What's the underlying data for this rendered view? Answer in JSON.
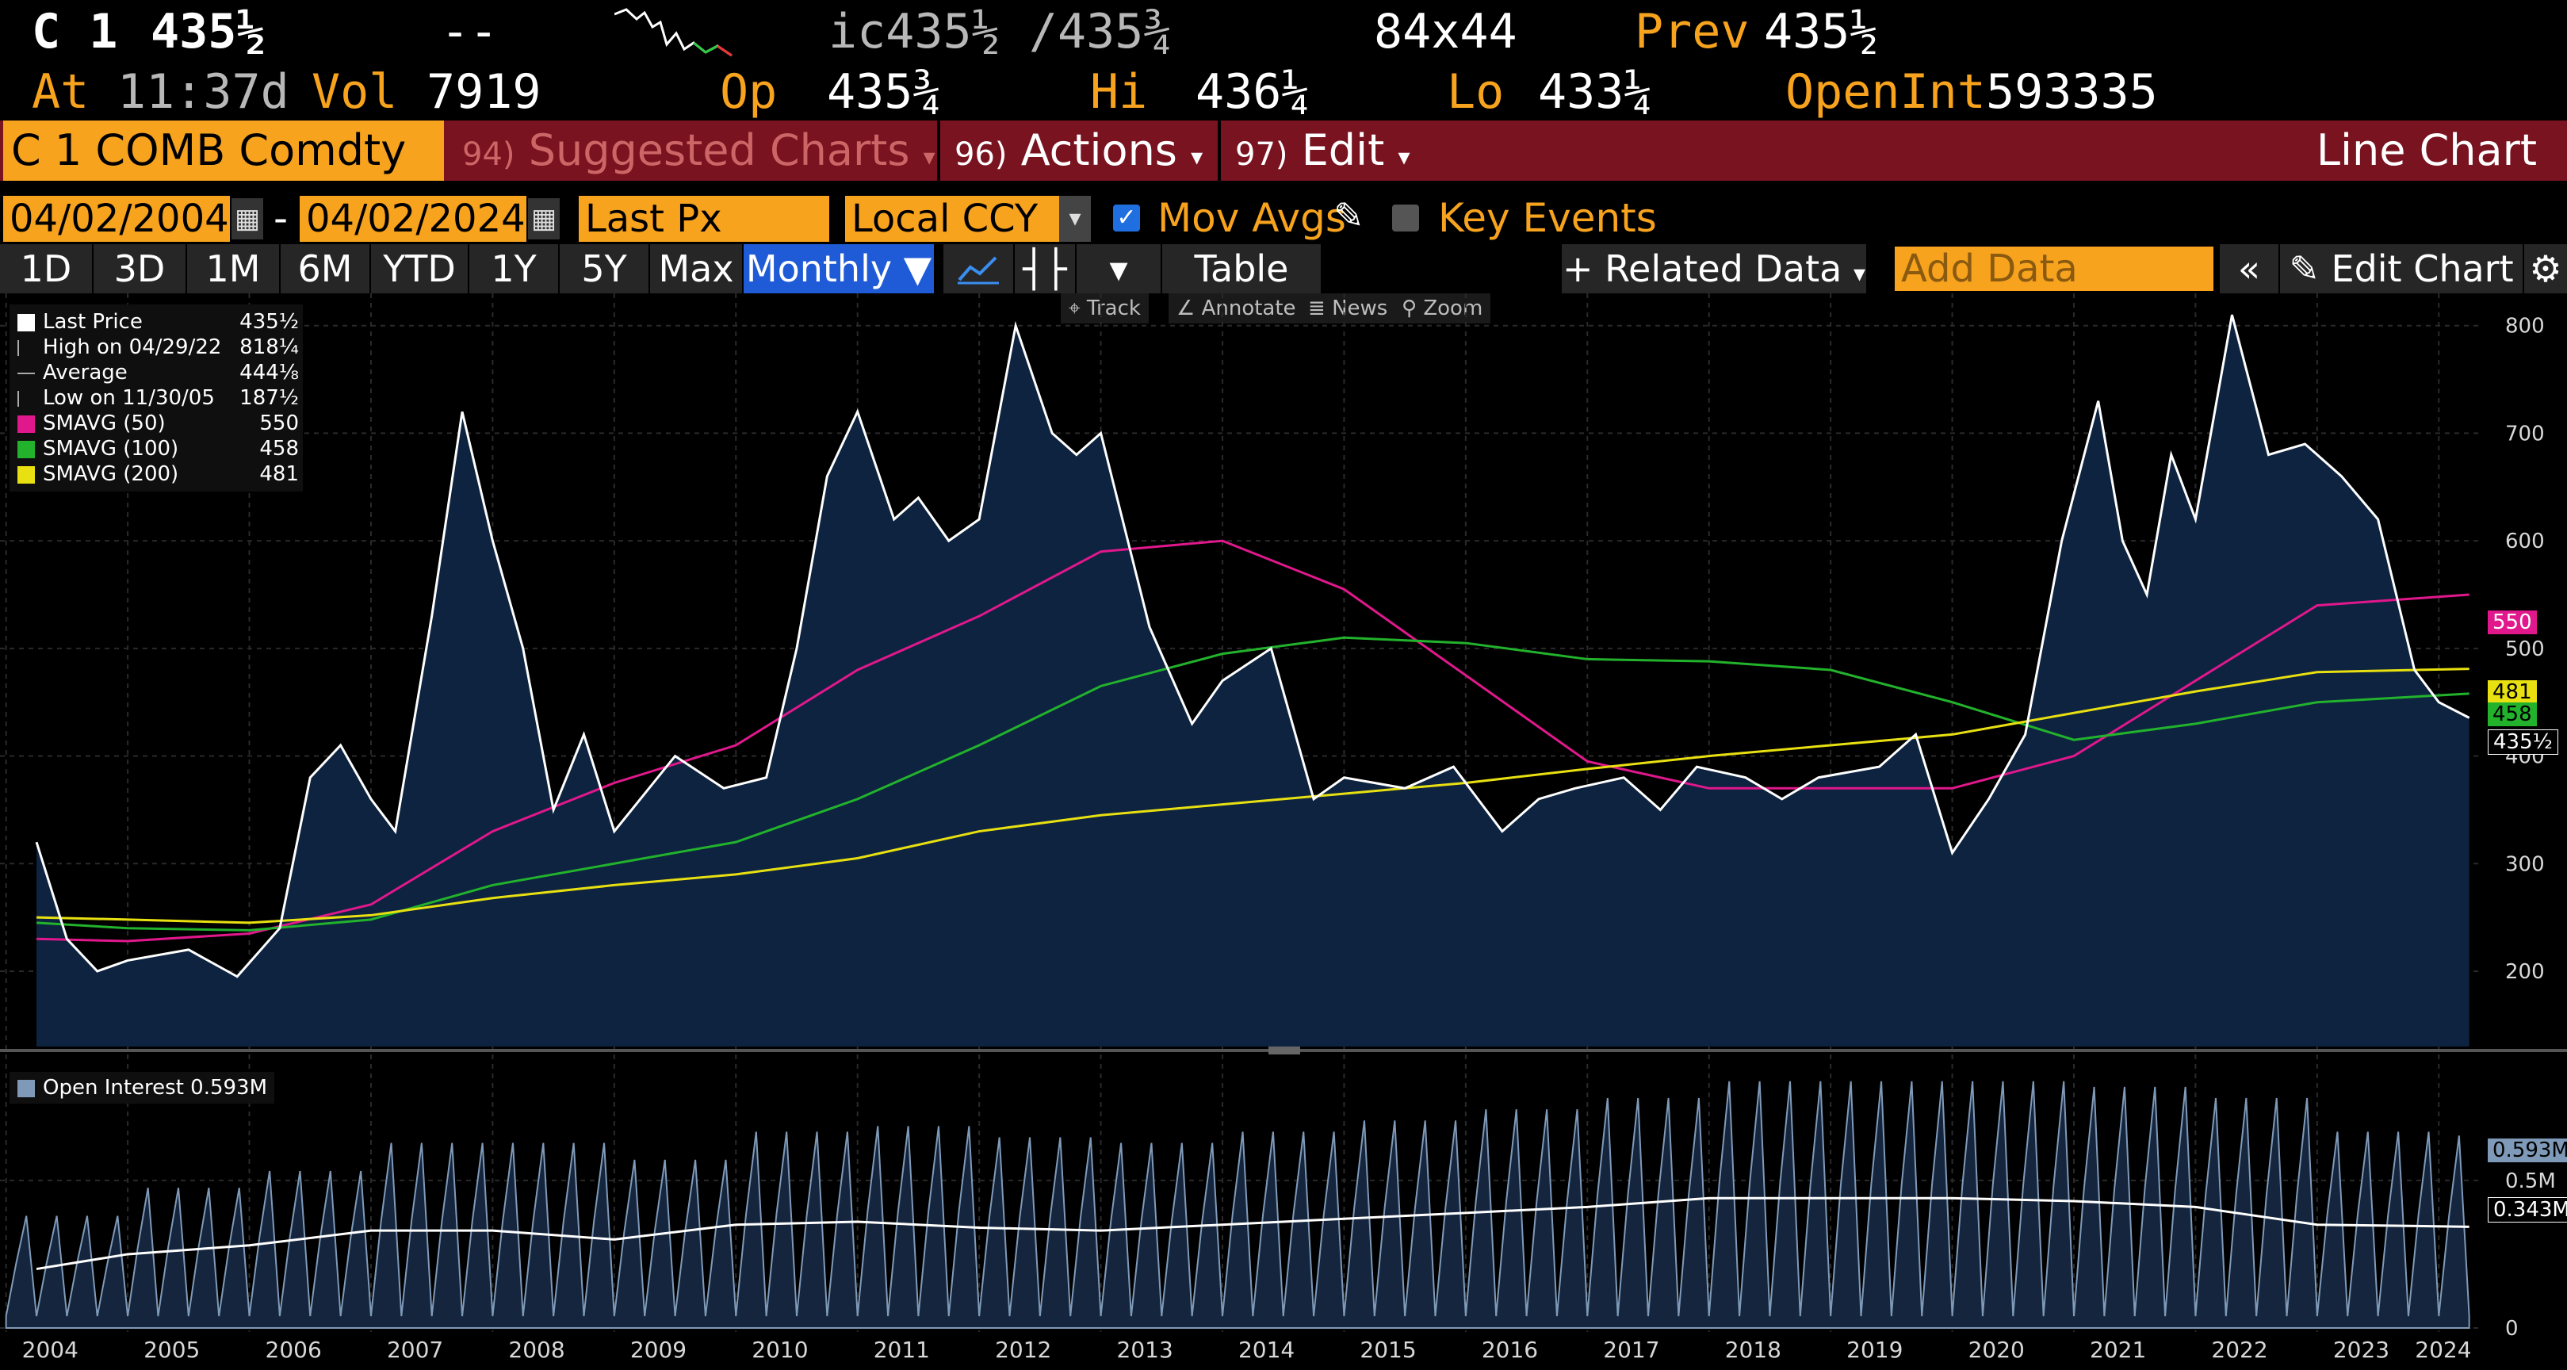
{
  "quote": {
    "ticker": "C 1",
    "last": "435½",
    "change": "--",
    "bid_ask": "ic435½ /435¾",
    "size": "84x44",
    "prev_label": "Prev",
    "prev": "435½",
    "at_label": "At",
    "time": "11:37d",
    "vol_label": "Vol",
    "vol": "7919",
    "op_label": "Op",
    "op": "435¾",
    "hi_label": "Hi",
    "hi": "436¼",
    "lo_label": "Lo",
    "lo": "433¼",
    "oi_label": "OpenInt",
    "oi": "593335"
  },
  "titlebar": {
    "security": "C 1 COMB Comdty",
    "suggested_num": "94)",
    "suggested": "Suggested Charts",
    "actions_num": "96)",
    "actions": "Actions",
    "edit_num": "97)",
    "edit": "Edit",
    "chart_type": "Line Chart"
  },
  "controls": {
    "start_date": "04/02/2004",
    "date_sep": "-",
    "end_date": "04/02/2024",
    "field": "Last Px",
    "currency": "Local CCY",
    "mov_avgs": "Mov Avgs",
    "key_events": "Key Events",
    "ranges": [
      "1D",
      "3D",
      "1M",
      "6M",
      "YTD",
      "1Y",
      "5Y",
      "Max"
    ],
    "period": "Monthly",
    "table": "Table",
    "related": "Related Data",
    "add_data_placeholder": "Add Data",
    "edit_chart": "Edit Chart",
    "tools": [
      "Track",
      "Annotate",
      "News",
      "Zoom"
    ]
  },
  "colors": {
    "accent": "#f7a31e",
    "titlebar": "#7a1320",
    "selected": "#1f5bd6",
    "area": "#0d2340",
    "sma50": "#e0188c",
    "sma100": "#22b22c",
    "sma200": "#e8e010",
    "oi_area": "#7f9ab8"
  },
  "legend": [
    {
      "label": "Last Price",
      "value": "435½",
      "swatch": "#ffffff"
    },
    {
      "label": "High on 04/29/22",
      "value": "818¼",
      "swatch": ""
    },
    {
      "label": "Average",
      "value": "444⅛",
      "swatch": ""
    },
    {
      "label": "Low on 11/30/05",
      "value": "187½",
      "swatch": ""
    },
    {
      "label": "SMAVG (50)",
      "value": "550",
      "swatch": "#e0188c"
    },
    {
      "label": "SMAVG (100)",
      "value": "458",
      "swatch": "#22b22c"
    },
    {
      "label": "SMAVG (200)",
      "value": "481",
      "swatch": "#e8e010"
    }
  ],
  "oi_legend": "Open Interest 0.593M",
  "axis_tags": {
    "sma50": "550",
    "sma200": "481",
    "sma100": "458",
    "last": "435½",
    "oi": "0.593M",
    "oi_avg": "0.343M"
  },
  "chart_data": {
    "type": "line",
    "ylim": [
      130,
      830
    ],
    "yticks": [
      200,
      300,
      400,
      500,
      600,
      700,
      800
    ],
    "x_years": [
      "2004",
      "2005",
      "2006",
      "2007",
      "2008",
      "2009",
      "2010",
      "2011",
      "2012",
      "2013",
      "2014",
      "2015",
      "2016",
      "2017",
      "2018",
      "2019",
      "2020",
      "2021",
      "2022",
      "2023",
      "2024"
    ],
    "series": [
      {
        "name": "Last Price",
        "color": "#ffffff",
        "x": [
          2004.25,
          2004.5,
          2004.75,
          2005.0,
          2005.5,
          2005.9,
          2006.25,
          2006.5,
          2006.75,
          2007.0,
          2007.2,
          2007.5,
          2007.75,
          2008.0,
          2008.25,
          2008.5,
          2008.75,
          2009.0,
          2009.5,
          2009.9,
          2010.25,
          2010.5,
          2010.75,
          2011.0,
          2011.3,
          2011.5,
          2011.75,
          2012.0,
          2012.3,
          2012.6,
          2012.8,
          2013.0,
          2013.4,
          2013.75,
          2014.0,
          2014.4,
          2014.75,
          2015.0,
          2015.5,
          2015.9,
          2016.3,
          2016.6,
          2016.9,
          2017.3,
          2017.6,
          2017.9,
          2018.3,
          2018.6,
          2018.9,
          2019.4,
          2019.7,
          2020.0,
          2020.3,
          2020.6,
          2020.9,
          2021.2,
          2021.4,
          2021.6,
          2021.8,
          2022.0,
          2022.3,
          2022.6,
          2022.9,
          2023.2,
          2023.5,
          2023.8,
          2024.0,
          2024.25
        ],
        "values": [
          320,
          230,
          200,
          210,
          220,
          195,
          240,
          380,
          410,
          360,
          330,
          530,
          720,
          600,
          500,
          350,
          420,
          330,
          400,
          370,
          380,
          500,
          660,
          720,
          620,
          640,
          600,
          620,
          800,
          700,
          680,
          700,
          520,
          430,
          470,
          500,
          360,
          380,
          370,
          390,
          330,
          360,
          370,
          380,
          350,
          390,
          380,
          360,
          380,
          390,
          420,
          310,
          360,
          420,
          600,
          730,
          600,
          550,
          680,
          620,
          810,
          680,
          690,
          660,
          620,
          480,
          450,
          435.5
        ]
      },
      {
        "name": "SMAVG (50)",
        "color": "#e0188c",
        "x": [
          2004.25,
          2005.0,
          2006.0,
          2007.0,
          2008.0,
          2009.0,
          2010.0,
          2011.0,
          2012.0,
          2013.0,
          2014.0,
          2015.0,
          2016.0,
          2017.0,
          2018.0,
          2019.0,
          2020.0,
          2021.0,
          2022.0,
          2023.0,
          2024.25
        ],
        "values": [
          230,
          228,
          235,
          262,
          330,
          375,
          410,
          480,
          530,
          590,
          600,
          555,
          475,
          395,
          370,
          370,
          370,
          400,
          470,
          540,
          550
        ]
      },
      {
        "name": "SMAVG (100)",
        "color": "#22b22c",
        "x": [
          2004.25,
          2005.0,
          2006.0,
          2007.0,
          2008.0,
          2009.0,
          2010.0,
          2011.0,
          2012.0,
          2013.0,
          2014.0,
          2015.0,
          2016.0,
          2017.0,
          2018.0,
          2019.0,
          2020.0,
          2021.0,
          2022.0,
          2023.0,
          2024.25
        ],
        "values": [
          245,
          240,
          238,
          248,
          280,
          300,
          320,
          360,
          410,
          465,
          495,
          510,
          505,
          490,
          488,
          480,
          450,
          415,
          430,
          450,
          458
        ]
      },
      {
        "name": "SMAVG (200)",
        "color": "#e8e010",
        "x": [
          2004.25,
          2005.0,
          2006.0,
          2007.0,
          2008.0,
          2009.0,
          2010.0,
          2011.0,
          2012.0,
          2013.0,
          2014.0,
          2015.0,
          2016.0,
          2017.0,
          2018.0,
          2019.0,
          2020.0,
          2021.0,
          2022.0,
          2023.0,
          2024.25
        ],
        "values": [
          250,
          248,
          245,
          252,
          268,
          280,
          290,
          305,
          330,
          345,
          355,
          365,
          375,
          388,
          400,
          410,
          420,
          440,
          460,
          478,
          481
        ]
      }
    ],
    "oi": {
      "ylim": [
        0,
        0.9
      ],
      "yticks": [
        {
          "v": 0,
          "label": "0"
        },
        {
          "v": 0.5,
          "label": "0.5M"
        }
      ],
      "avg_x": [
        2004.25,
        2005.0,
        2006.0,
        2007.0,
        2008.0,
        2009.0,
        2010.0,
        2011.0,
        2012.0,
        2013.0,
        2014.0,
        2015.0,
        2016.0,
        2017.0,
        2018.0,
        2019.0,
        2020.0,
        2021.0,
        2022.0,
        2023.0,
        2024.25
      ],
      "avg_values": [
        0.2,
        0.25,
        0.28,
        0.33,
        0.33,
        0.3,
        0.35,
        0.36,
        0.34,
        0.33,
        0.35,
        0.37,
        0.39,
        0.41,
        0.44,
        0.44,
        0.44,
        0.43,
        0.41,
        0.35,
        0.343
      ]
    }
  }
}
